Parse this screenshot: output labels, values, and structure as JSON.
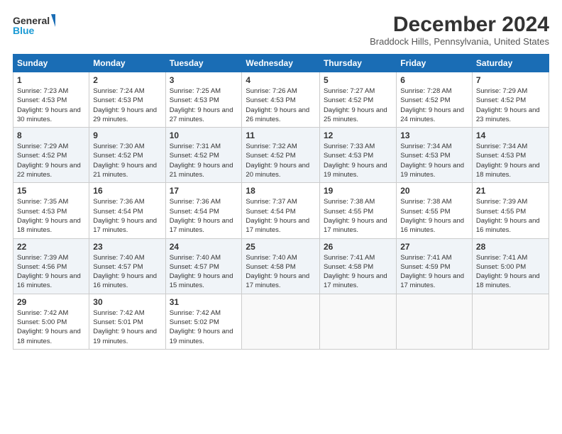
{
  "header": {
    "logo_line1": "General",
    "logo_line2": "Blue",
    "month_title": "December 2024",
    "subtitle": "Braddock Hills, Pennsylvania, United States"
  },
  "days_of_week": [
    "Sunday",
    "Monday",
    "Tuesday",
    "Wednesday",
    "Thursday",
    "Friday",
    "Saturday"
  ],
  "weeks": [
    [
      {
        "day": "1",
        "sunrise": "7:23 AM",
        "sunset": "4:53 PM",
        "daylight": "9 hours and 30 minutes."
      },
      {
        "day": "2",
        "sunrise": "7:24 AM",
        "sunset": "4:53 PM",
        "daylight": "9 hours and 29 minutes."
      },
      {
        "day": "3",
        "sunrise": "7:25 AM",
        "sunset": "4:53 PM",
        "daylight": "9 hours and 27 minutes."
      },
      {
        "day": "4",
        "sunrise": "7:26 AM",
        "sunset": "4:53 PM",
        "daylight": "9 hours and 26 minutes."
      },
      {
        "day": "5",
        "sunrise": "7:27 AM",
        "sunset": "4:52 PM",
        "daylight": "9 hours and 25 minutes."
      },
      {
        "day": "6",
        "sunrise": "7:28 AM",
        "sunset": "4:52 PM",
        "daylight": "9 hours and 24 minutes."
      },
      {
        "day": "7",
        "sunrise": "7:29 AM",
        "sunset": "4:52 PM",
        "daylight": "9 hours and 23 minutes."
      }
    ],
    [
      {
        "day": "8",
        "sunrise": "7:29 AM",
        "sunset": "4:52 PM",
        "daylight": "9 hours and 22 minutes."
      },
      {
        "day": "9",
        "sunrise": "7:30 AM",
        "sunset": "4:52 PM",
        "daylight": "9 hours and 21 minutes."
      },
      {
        "day": "10",
        "sunrise": "7:31 AM",
        "sunset": "4:52 PM",
        "daylight": "9 hours and 21 minutes."
      },
      {
        "day": "11",
        "sunrise": "7:32 AM",
        "sunset": "4:52 PM",
        "daylight": "9 hours and 20 minutes."
      },
      {
        "day": "12",
        "sunrise": "7:33 AM",
        "sunset": "4:53 PM",
        "daylight": "9 hours and 19 minutes."
      },
      {
        "day": "13",
        "sunrise": "7:34 AM",
        "sunset": "4:53 PM",
        "daylight": "9 hours and 19 minutes."
      },
      {
        "day": "14",
        "sunrise": "7:34 AM",
        "sunset": "4:53 PM",
        "daylight": "9 hours and 18 minutes."
      }
    ],
    [
      {
        "day": "15",
        "sunrise": "7:35 AM",
        "sunset": "4:53 PM",
        "daylight": "9 hours and 18 minutes."
      },
      {
        "day": "16",
        "sunrise": "7:36 AM",
        "sunset": "4:54 PM",
        "daylight": "9 hours and 17 minutes."
      },
      {
        "day": "17",
        "sunrise": "7:36 AM",
        "sunset": "4:54 PM",
        "daylight": "9 hours and 17 minutes."
      },
      {
        "day": "18",
        "sunrise": "7:37 AM",
        "sunset": "4:54 PM",
        "daylight": "9 hours and 17 minutes."
      },
      {
        "day": "19",
        "sunrise": "7:38 AM",
        "sunset": "4:55 PM",
        "daylight": "9 hours and 17 minutes."
      },
      {
        "day": "20",
        "sunrise": "7:38 AM",
        "sunset": "4:55 PM",
        "daylight": "9 hours and 16 minutes."
      },
      {
        "day": "21",
        "sunrise": "7:39 AM",
        "sunset": "4:55 PM",
        "daylight": "9 hours and 16 minutes."
      }
    ],
    [
      {
        "day": "22",
        "sunrise": "7:39 AM",
        "sunset": "4:56 PM",
        "daylight": "9 hours and 16 minutes."
      },
      {
        "day": "23",
        "sunrise": "7:40 AM",
        "sunset": "4:57 PM",
        "daylight": "9 hours and 16 minutes."
      },
      {
        "day": "24",
        "sunrise": "7:40 AM",
        "sunset": "4:57 PM",
        "daylight": "9 hours and 15 minutes."
      },
      {
        "day": "25",
        "sunrise": "7:40 AM",
        "sunset": "4:58 PM",
        "daylight": "9 hours and 17 minutes."
      },
      {
        "day": "26",
        "sunrise": "7:41 AM",
        "sunset": "4:58 PM",
        "daylight": "9 hours and 17 minutes."
      },
      {
        "day": "27",
        "sunrise": "7:41 AM",
        "sunset": "4:59 PM",
        "daylight": "9 hours and 17 minutes."
      },
      {
        "day": "28",
        "sunrise": "7:41 AM",
        "sunset": "5:00 PM",
        "daylight": "9 hours and 18 minutes."
      }
    ],
    [
      {
        "day": "29",
        "sunrise": "7:42 AM",
        "sunset": "5:00 PM",
        "daylight": "9 hours and 18 minutes."
      },
      {
        "day": "30",
        "sunrise": "7:42 AM",
        "sunset": "5:01 PM",
        "daylight": "9 hours and 19 minutes."
      },
      {
        "day": "31",
        "sunrise": "7:42 AM",
        "sunset": "5:02 PM",
        "daylight": "9 hours and 19 minutes."
      },
      null,
      null,
      null,
      null
    ]
  ],
  "labels": {
    "sunrise": "Sunrise:",
    "sunset": "Sunset:",
    "daylight": "Daylight:"
  }
}
